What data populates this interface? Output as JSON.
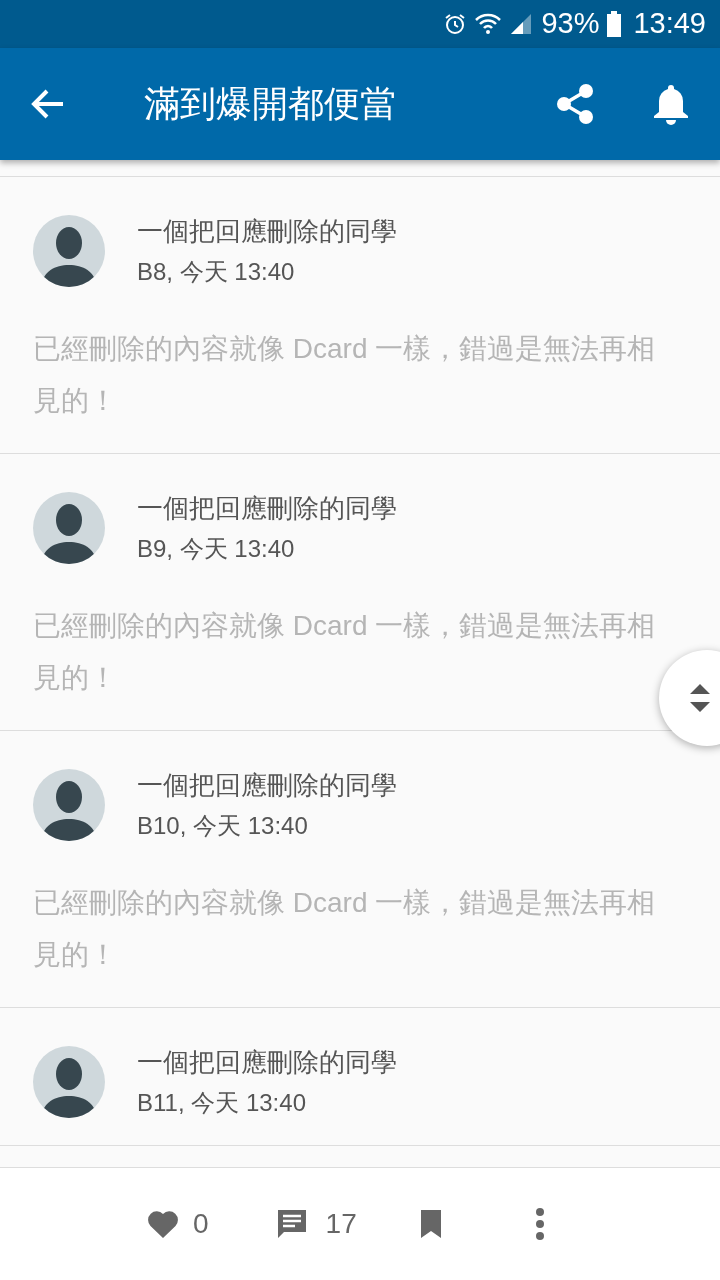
{
  "status_bar": {
    "battery": "93%",
    "time": "13:49"
  },
  "app_bar": {
    "title": "滿到爆開都便當"
  },
  "posts": [
    {
      "author": "一個把回應刪除的同學",
      "meta": "B8, 今天 13:40",
      "body": "已經刪除的內容就像 Dcard 一樣，錯過是無法再相見的！"
    },
    {
      "author": "一個把回應刪除的同學",
      "meta": "B9, 今天 13:40",
      "body": "已經刪除的內容就像 Dcard 一樣，錯過是無法再相見的！"
    },
    {
      "author": "一個把回應刪除的同學",
      "meta": "B10, 今天 13:40",
      "body": "已經刪除的內容就像 Dcard 一樣，錯過是無法再相見的！"
    },
    {
      "author": "一個把回應刪除的同學",
      "meta": "B11, 今天 13:40"
    }
  ],
  "bottom_bar": {
    "likes": "0",
    "comments": "17"
  }
}
